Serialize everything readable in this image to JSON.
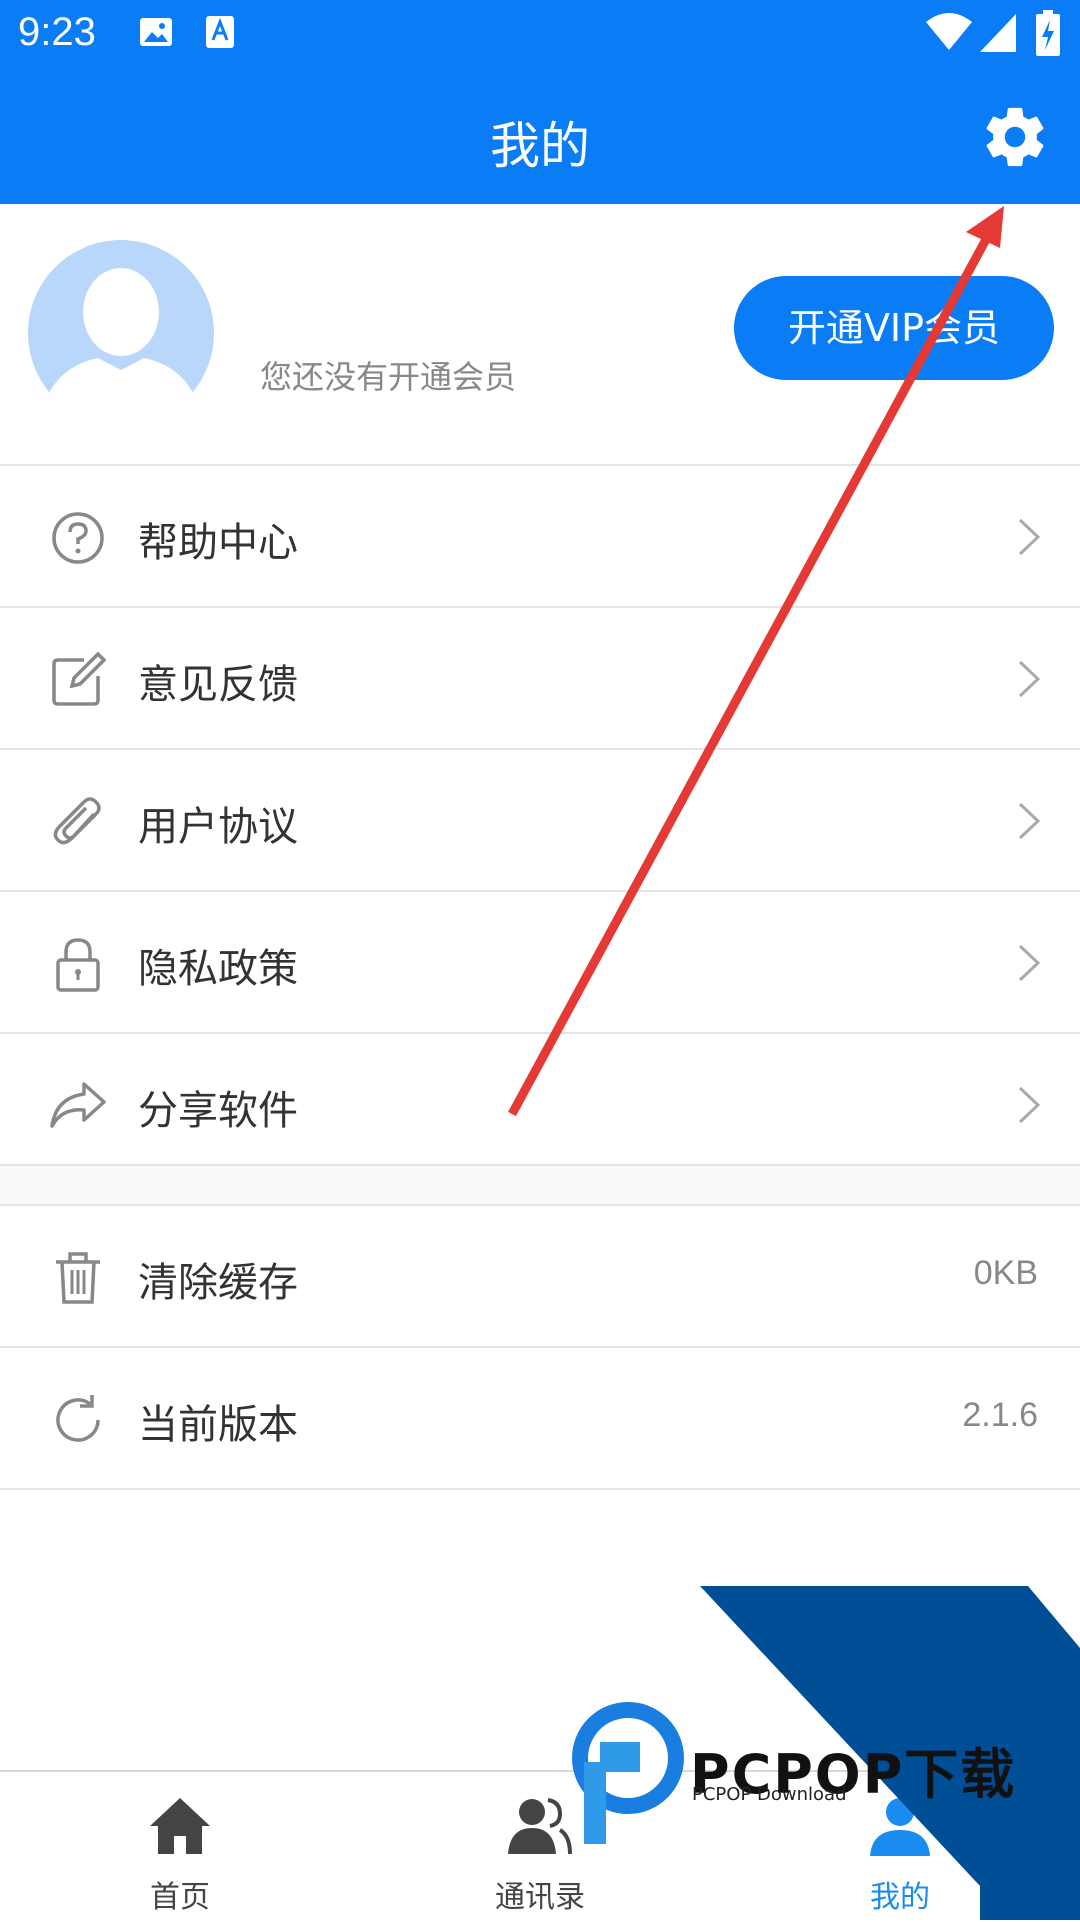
{
  "status_bar": {
    "time": "9:23"
  },
  "header": {
    "title": "我的"
  },
  "profile": {
    "member_status": "您还没有开通会员",
    "vip_button": "开通VIP会员"
  },
  "menu": [
    {
      "label": "帮助中心",
      "icon": "help-circle-icon"
    },
    {
      "label": "意见反馈",
      "icon": "edit-icon"
    },
    {
      "label": "用户协议",
      "icon": "paperclip-icon"
    },
    {
      "label": "隐私政策",
      "icon": "lock-icon"
    },
    {
      "label": "分享软件",
      "icon": "share-icon"
    }
  ],
  "settings_rows": [
    {
      "label": "清除缓存",
      "value": "0KB",
      "icon": "trash-icon"
    },
    {
      "label": "当前版本",
      "value": "2.1.6",
      "icon": "refresh-icon"
    }
  ],
  "tabs": [
    {
      "label": "首页",
      "icon": "home-icon"
    },
    {
      "label": "通讯录",
      "icon": "contacts-icon"
    },
    {
      "label": "我的",
      "icon": "person-icon",
      "active": true
    }
  ],
  "watermark": {
    "brand": "PCPOP下载",
    "sub": "PCPOP Download"
  },
  "colors": {
    "accent": "#0a7cf5",
    "annotation_arrow": "#e53935"
  }
}
